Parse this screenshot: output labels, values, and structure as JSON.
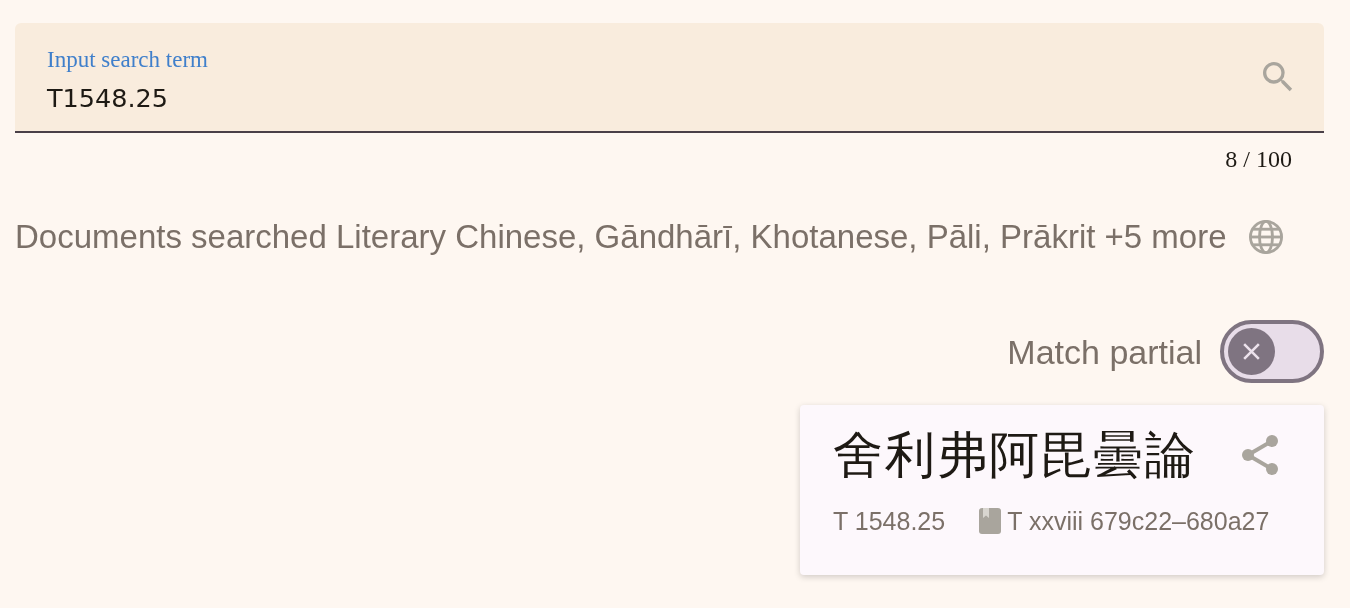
{
  "search": {
    "label": "Input search term",
    "value": "T1548.25",
    "counter": "8 / 100"
  },
  "documents": {
    "text": "Documents searched Literary Chinese, Gāndhārī, Khotanese, Pāli, Prākrit +5 more"
  },
  "match_partial": {
    "label": "Match partial",
    "on": false
  },
  "result": {
    "title": "舍利弗阿毘曇論",
    "id": "T 1548.25",
    "reference": "T xxviii 679c22–680a27"
  }
}
